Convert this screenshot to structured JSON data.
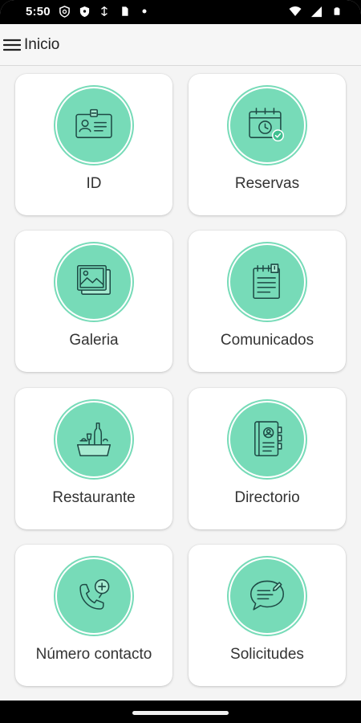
{
  "status_bar": {
    "time": "5:50",
    "icons_left": [
      "shield-icon",
      "vpn-icon",
      "data-saver-icon",
      "sim-icon",
      "dot-icon"
    ],
    "icons_right": [
      "wifi-icon",
      "signal-icon",
      "battery-icon"
    ]
  },
  "app_bar": {
    "menu_icon": "hamburger-menu-icon",
    "title": "Inicio"
  },
  "menu": {
    "items": [
      {
        "label": "ID",
        "icon": "id-card-icon"
      },
      {
        "label": "Reservas",
        "icon": "calendar-check-icon"
      },
      {
        "label": "Galeria",
        "icon": "photo-gallery-icon"
      },
      {
        "label": "Comunicados",
        "icon": "notepad-icon"
      },
      {
        "label": "Restaurante",
        "icon": "restaurant-table-icon"
      },
      {
        "label": "Directorio",
        "icon": "address-book-icon"
      },
      {
        "label": "Número contacto",
        "icon": "phone-contact-icon"
      },
      {
        "label": "Solicitudes",
        "icon": "message-request-icon"
      }
    ]
  },
  "colors": {
    "accent": "#77dbb8",
    "icon_stroke": "#1e4a45",
    "card_bg": "#ffffff",
    "page_bg": "#f4f4f4"
  }
}
